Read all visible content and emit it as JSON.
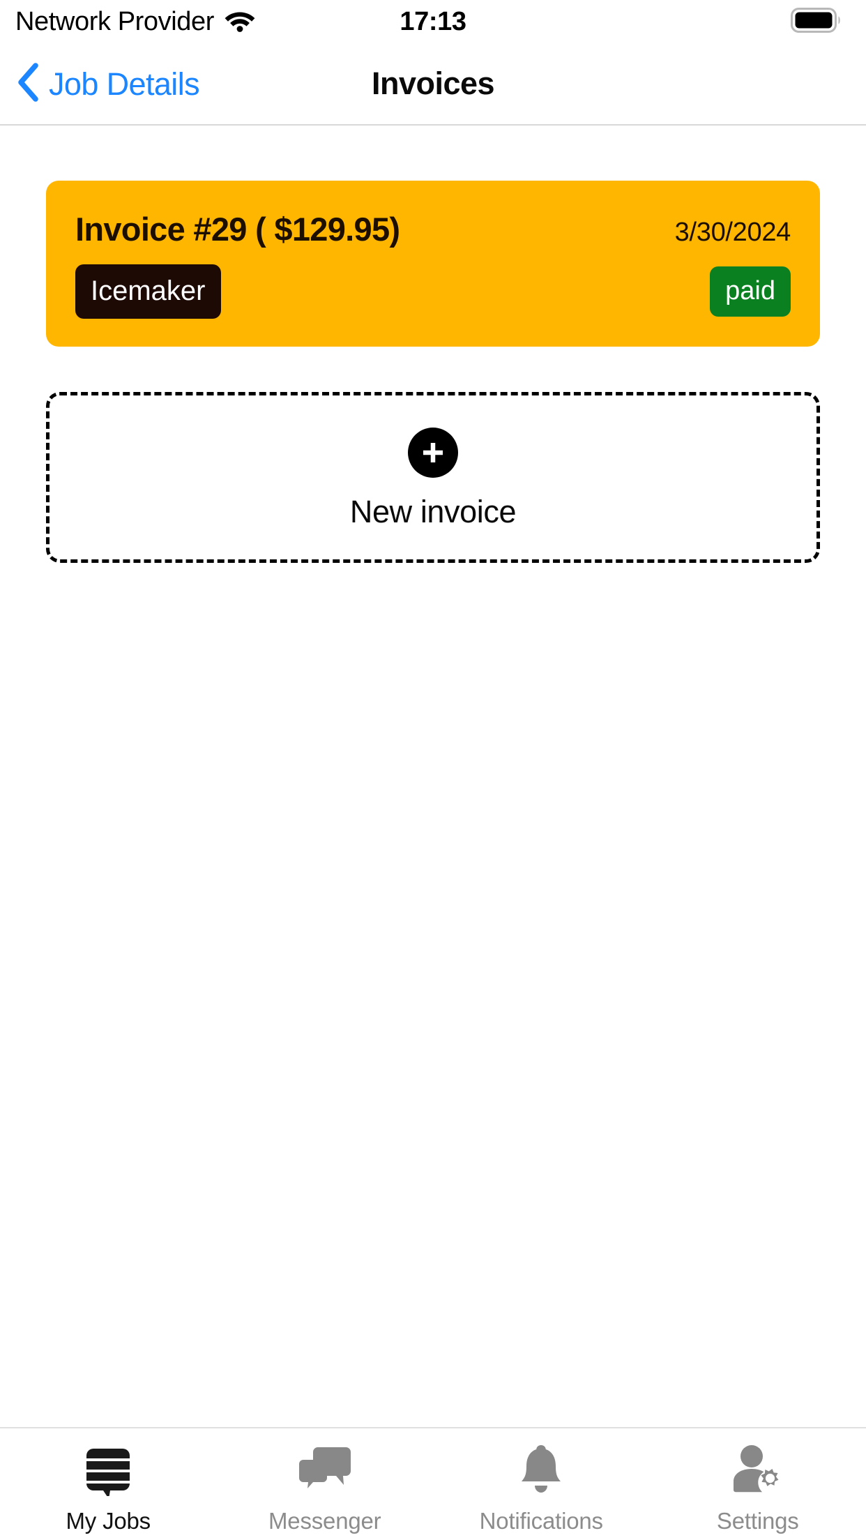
{
  "status_bar": {
    "carrier": "Network Provider",
    "wifi_icon": "wifi-icon",
    "time": "17:13",
    "battery_icon": "battery-full-icon"
  },
  "nav_bar": {
    "back_icon": "chevron-left-icon",
    "back_label": "Job Details",
    "title": "Invoices"
  },
  "invoices": [
    {
      "title": "Invoice #29 ( $129.95)",
      "date": "3/30/2024",
      "category": "Icemaker",
      "status": "paid",
      "card_color": "#ffb600",
      "category_color": "#1d0a05",
      "status_color": "#0a8020"
    }
  ],
  "new_invoice": {
    "plus_icon": "plus-icon",
    "label": "New invoice"
  },
  "tab_bar": {
    "items": [
      {
        "label": "My Jobs",
        "icon": "jobs-bubble-icon",
        "active": true
      },
      {
        "label": "Messenger",
        "icon": "chat-bubbles-icon",
        "active": false
      },
      {
        "label": "Notifications",
        "icon": "bell-icon",
        "active": false
      },
      {
        "label": "Settings",
        "icon": "user-gear-icon",
        "active": false
      }
    ]
  },
  "colors": {
    "accent_blue": "#1b86ff",
    "card_amber": "#ffb600",
    "paid_green": "#0a8020",
    "tab_inactive": "#8c8c8c",
    "tab_active": "#111111"
  }
}
